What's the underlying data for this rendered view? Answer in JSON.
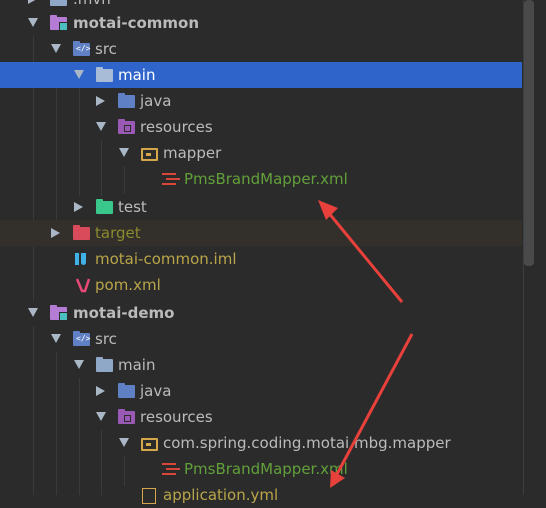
{
  "tree": {
    "items": [
      {
        "label": ".mvn"
      },
      {
        "label": "motai-common"
      },
      {
        "label": "src"
      },
      {
        "label": "main"
      },
      {
        "label": "java"
      },
      {
        "label": "resources"
      },
      {
        "label": "mapper"
      },
      {
        "label": "PmsBrandMapper.xml"
      },
      {
        "label": "test"
      },
      {
        "label": "target"
      },
      {
        "label": "motai-common.iml"
      },
      {
        "label": "pom.xml"
      },
      {
        "label": "motai-demo"
      },
      {
        "label": "src"
      },
      {
        "label": "main"
      },
      {
        "label": "java"
      },
      {
        "label": "resources"
      },
      {
        "label": "com.spring.coding.motai.mbg.mapper"
      },
      {
        "label": "PmsBrandMapper.xml"
      },
      {
        "label": "application.yml"
      }
    ]
  },
  "colors": {
    "selection": "#2f65ca",
    "arrow": "#e8413b",
    "folder": "#8fa8c8",
    "module_folder": "#b57cd6",
    "resources_folder": "#9b59b6",
    "test_folder": "#39c78c",
    "target_folder": "#d94a5a"
  },
  "icons": [
    "folder-icon",
    "module-folder-icon",
    "source-folder-icon",
    "resources-folder-icon",
    "package-folder-icon",
    "test-folder-icon",
    "excluded-folder-icon",
    "xml-file-icon",
    "iml-file-icon",
    "maven-pom-icon",
    "yaml-file-icon",
    "annotation-arrow"
  ]
}
